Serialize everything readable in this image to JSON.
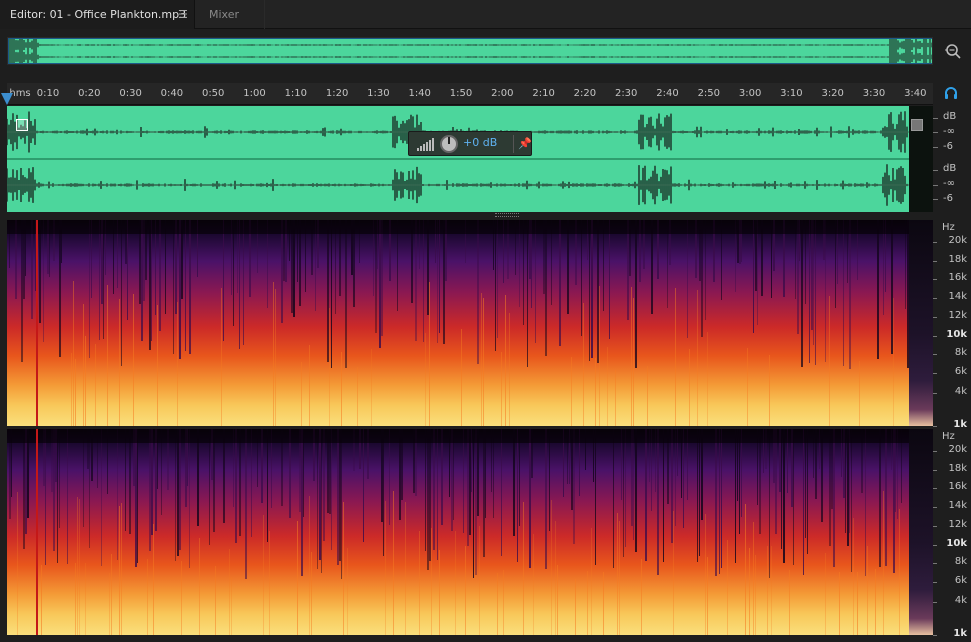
{
  "tabs": {
    "editor": "Editor: 01 - Office Plankton.mp3",
    "editor_menu_icon": "hamburger-menu-icon",
    "mixer": "Mixer"
  },
  "colors": {
    "waveform_bg": "#4cd69c",
    "waveform_fg": "#111111",
    "selection_border": "#1a5a88",
    "playhead": "#3c8ecf",
    "volume_text": "#5fb2f0"
  },
  "ruler": {
    "unit": "hms",
    "ticks": [
      "0:10",
      "0:20",
      "0:30",
      "0:40",
      "0:50",
      "1:00",
      "1:10",
      "1:20",
      "1:30",
      "1:40",
      "1:50",
      "2:00",
      "2:10",
      "2:20",
      "2:30",
      "2:40",
      "2:50",
      "3:00",
      "3:10",
      "3:20",
      "3:30",
      "3:40"
    ]
  },
  "volume_hud": {
    "value": "+0 dB"
  },
  "db_scale": {
    "ch1": {
      "unit": "dB",
      "inf": "-∞",
      "minus6": "-6"
    },
    "ch2": {
      "unit": "dB",
      "inf": "-∞",
      "minus6": "-6"
    }
  },
  "hz_scale": {
    "unit": "Hz",
    "labels": [
      "20k",
      "18k",
      "16k",
      "14k",
      "12k",
      "10k",
      "8k",
      "6k",
      "4k",
      "1k"
    ],
    "bold": [
      "10k",
      "1k"
    ]
  },
  "icons": [
    "zoom-magnifier-icon",
    "headphones-icon",
    "hamburger-menu-icon",
    "pin-icon",
    "volume-knob-icon"
  ]
}
